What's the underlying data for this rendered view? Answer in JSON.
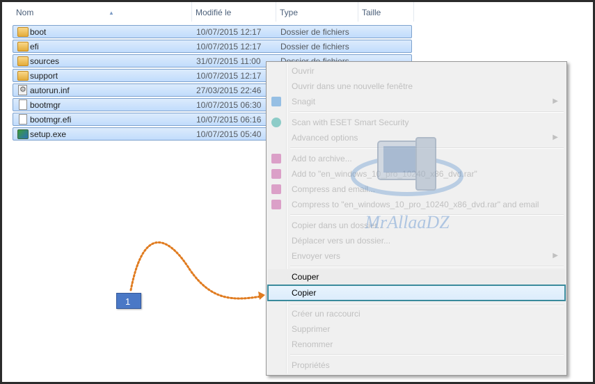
{
  "columns": {
    "name": "Nom",
    "modified": "Modifié le",
    "type": "Type",
    "size": "Taille"
  },
  "files": [
    {
      "name": "boot",
      "date": "10/07/2015 12:17",
      "type": "Dossier de fichiers",
      "icon": "folder-icon"
    },
    {
      "name": "efi",
      "date": "10/07/2015 12:17",
      "type": "Dossier de fichiers",
      "icon": "folder-icon"
    },
    {
      "name": "sources",
      "date": "31/07/2015 11:00",
      "type": "Dossier de fichiers",
      "icon": "folder-icon"
    },
    {
      "name": "support",
      "date": "10/07/2015 12:17",
      "type": "Dossier de fichiers",
      "icon": "folder-icon"
    },
    {
      "name": "autorun.inf",
      "date": "27/03/2015 22:46",
      "type": "",
      "icon": "settings-file-icon"
    },
    {
      "name": "bootmgr",
      "date": "10/07/2015 06:30",
      "type": "",
      "icon": "file-icon"
    },
    {
      "name": "bootmgr.efi",
      "date": "10/07/2015 06:16",
      "type": "",
      "icon": "file-icon"
    },
    {
      "name": "setup.exe",
      "date": "10/07/2015 05:40",
      "type": "",
      "icon": "setup-icon"
    }
  ],
  "context_menu": {
    "open": "Ouvrir",
    "open_new_window": "Ouvrir dans une nouvelle fenêtre",
    "snagit": "Snagit",
    "scan_eset": "Scan with ESET Smart Security",
    "advanced_options": "Advanced options",
    "add_archive": "Add to archive...",
    "add_rar": "Add to \"en_windows_10_pro_10240_x86_dvd.rar\"",
    "compress_email": "Compress and email...",
    "compress_rar_email": "Compress to \"en_windows_10_pro_10240_x86_dvd.rar\" and email",
    "copy_to_folder": "Copier dans un dossier...",
    "move_to_folder": "Déplacer vers un dossier...",
    "send_to": "Envoyer vers",
    "cut": "Couper",
    "copy": "Copier",
    "create_shortcut": "Créer un raccourci",
    "delete": "Supprimer",
    "rename": "Renommer",
    "properties": "Propriétés"
  },
  "callout": {
    "label": "1"
  },
  "watermark": {
    "text": "MrAllaaDZ"
  },
  "colors": {
    "selection": "#c1dcfc",
    "selection_border": "#7da2ce",
    "callout": "#4a78c6",
    "arrow": "#e07b1f",
    "highlight_border": "#3a8a9c"
  }
}
